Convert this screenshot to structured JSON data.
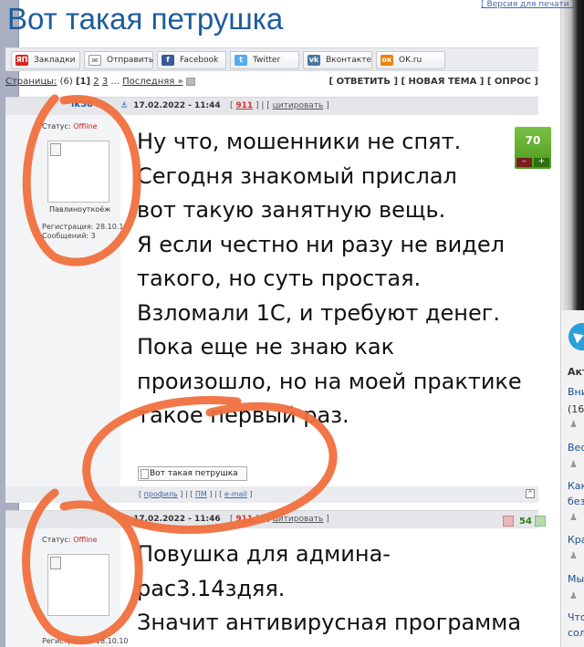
{
  "version_link": "[ Версия для печати ]",
  "topic_title": "Вот такая петрушка",
  "share_buttons": [
    {
      "label": "Закладки",
      "icon": "yandex-bookmarks-icon",
      "color": "#d9251c",
      "glyph": "ЯП"
    },
    {
      "label": "Отправить",
      "icon": "mail-icon",
      "color": "#8a8f97",
      "glyph": "✉"
    },
    {
      "label": "Facebook",
      "icon": "facebook-icon",
      "color": "#3b5998",
      "glyph": "f"
    },
    {
      "label": "Twitter",
      "icon": "twitter-icon",
      "color": "#55acee",
      "glyph": "t"
    },
    {
      "label": "Вконтакте",
      "icon": "vk-icon",
      "color": "#4c75a3",
      "glyph": "vk"
    },
    {
      "label": "OK.ru",
      "icon": "odnoklassniki-icon",
      "color": "#ee8208",
      "glyph": "ок"
    }
  ],
  "pager": {
    "label": "Страницы:",
    "count": "(6)",
    "current": "[1]",
    "p2": "2",
    "p3": "3",
    "dots": "...",
    "last": "Последняя »"
  },
  "topic_actions": "[ ОТВЕТИТЬ ] [ НОВАЯ ТЕМА ] [ ОПРОС ]",
  "posts": [
    {
      "nick": "ik58",
      "date": "17.02.2022 - 11:44",
      "num": "911",
      "quote": "цитировать",
      "status_label": "Статус:",
      "status_value": "Offline",
      "user_title": "Павлиноуткоёж",
      "reg": "Регистрация: 28.10.1",
      "msgs": "Сообщений: 3",
      "rating": "70",
      "rating_minus": "–",
      "rating_plus": "+",
      "lines": [
        "Ну что, мошенники не спят.",
        "Сегодня знакомый прислал",
        "вот такую занятную вещь.",
        "Я если честно ни разу не видел",
        "такого, но суть простая.",
        "Взломали 1С, и требуют денег.",
        "Пока еще не знаю как",
        "произошло, но на моей практике",
        "такое первый раз."
      ],
      "image_alt": "Вот такая петрушка",
      "foot_links": [
        "профиль",
        "ПМ",
        "e-mail"
      ],
      "top_arrow": "^"
    },
    {
      "date": "17.02.2022 - 11:46",
      "num": "911",
      "quote": "цитировать",
      "status_label": "Статус:",
      "status_value": "Offline",
      "reg": "Регистрация: 18.10.10",
      "rating": "54",
      "lines": [
        "Повушка для админа-",
        "pac3.14здяя.",
        "Значит антивирусная программа"
      ]
    }
  ],
  "sidebar": {
    "heading": "Акт",
    "items": [
      "Вни",
      "(16)",
      "Вес",
      "Как",
      "без",
      "Кра",
      "Мы",
      "Что",
      "сол"
    ]
  },
  "colors": {
    "title": "#1d5c9b",
    "link": "#4667a8",
    "offline": "#c22",
    "rating_green": "#4a9a1d",
    "scribble": "#f0703e"
  }
}
